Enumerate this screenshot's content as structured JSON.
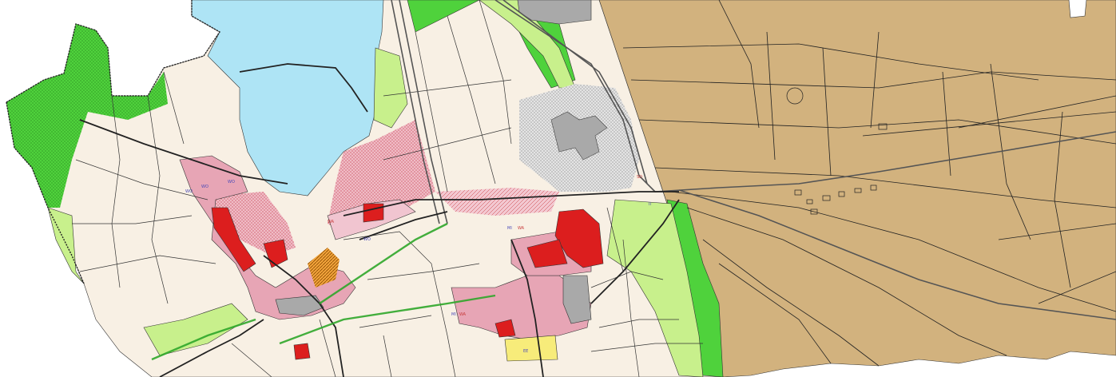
{
  "map": {
    "colors": {
      "background": "#ffffff",
      "water": "#aee4f5",
      "agriculture": "#f8f0e4",
      "forest": "#4fd23c",
      "meadow": "#c8f08c",
      "residential": "#e7a5b5",
      "mixed_pink": "#f1c5d0",
      "core_red": "#dc1e1e",
      "industrial_grey": "#a9a9a9",
      "special_grey": "#dcdcdc",
      "mining": "#d2b27e",
      "yellow_special": "#f7ec7a",
      "orange_special": "#f2a43c",
      "roads": "#222222",
      "rail": "#555555"
    }
  },
  "labels": [
    {
      "id": "wo-1",
      "text": "WO"
    },
    {
      "id": "wo-2",
      "text": "WO"
    },
    {
      "id": "wo-3",
      "text": "WO"
    },
    {
      "id": "wo-4",
      "text": "WO"
    },
    {
      "id": "wa-1",
      "text": "WA"
    },
    {
      "id": "wa-2",
      "text": "WA"
    },
    {
      "id": "wa-3",
      "text": "WA"
    },
    {
      "id": "mi-1",
      "text": "MI"
    },
    {
      "id": "mi-2",
      "text": "MI"
    },
    {
      "id": "sd-1",
      "text": "SD"
    },
    {
      "id": "ii-1",
      "text": "II"
    },
    {
      "id": "ee-1",
      "text": "EE"
    }
  ]
}
